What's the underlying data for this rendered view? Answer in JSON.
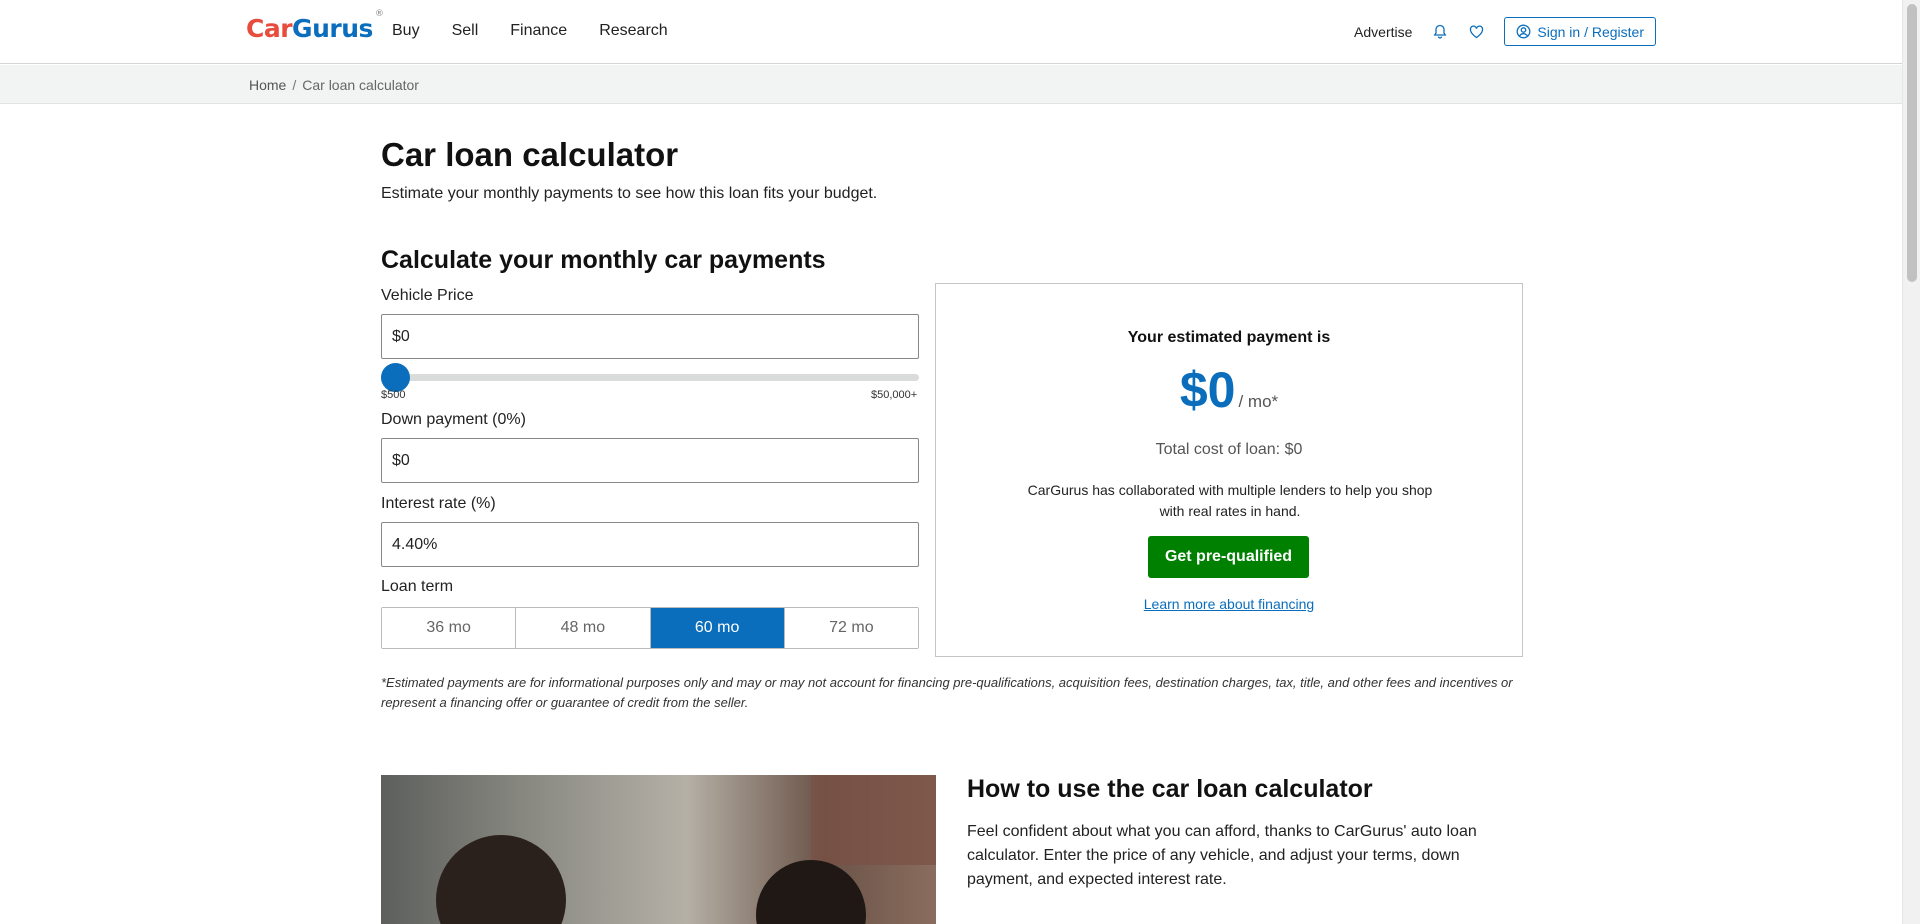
{
  "header": {
    "logo": {
      "part1": "Car",
      "part2": "Gurus",
      "mark": "®"
    },
    "nav": [
      "Buy",
      "Sell",
      "Finance",
      "Research"
    ],
    "advertise": "Advertise",
    "bell_icon": "bell-icon",
    "heart_icon": "heart-icon",
    "signin_label": "Sign in / Register"
  },
  "breadcrumb": {
    "home": "Home",
    "separator": "/",
    "current": "Car loan calculator"
  },
  "page": {
    "title": "Car loan calculator",
    "subtitle": "Estimate your monthly payments to see how this loan fits your budget.",
    "section_title": "Calculate your monthly car payments"
  },
  "form": {
    "vehicle_price_label": "Vehicle Price",
    "vehicle_price_value": "$0",
    "slider_min": "$500",
    "slider_max": "$50,000+",
    "slider_fraction": 0,
    "down_payment_label": "Down payment (0%)",
    "down_payment_value": "$0",
    "interest_label": "Interest rate (%)",
    "interest_value": "4.40%",
    "loan_term_label": "Loan term",
    "terms": [
      "36 mo",
      "48 mo",
      "60 mo",
      "72 mo"
    ],
    "selected_term": "60 mo"
  },
  "result": {
    "title": "Your estimated payment is",
    "amount": "$0",
    "per": "/ mo*",
    "total": "Total cost of loan: $0",
    "collab": "CarGurus has collaborated with multiple lenders to help you shop with real rates in hand.",
    "prequal_button": "Get pre-qualified",
    "learn_link": "Learn more about financing"
  },
  "disclaimer": "*Estimated payments are for informational purposes only and may or may not account for financing pre-qualifications, acquisition fees, destination charges, tax, title, and other fees and incentives or represent a financing offer or guarantee of credit from the seller.",
  "howto": {
    "title": "How to use the car loan calculator",
    "para": "Feel confident about what you can afford, thanks to CarGurus' auto loan calculator. Enter the price of any vehicle, and adjust your terms, down payment, and expected interest rate."
  },
  "colors": {
    "brand_blue": "#0a6ebd",
    "brand_red": "#e84c3d",
    "cta_green": "#008000"
  }
}
